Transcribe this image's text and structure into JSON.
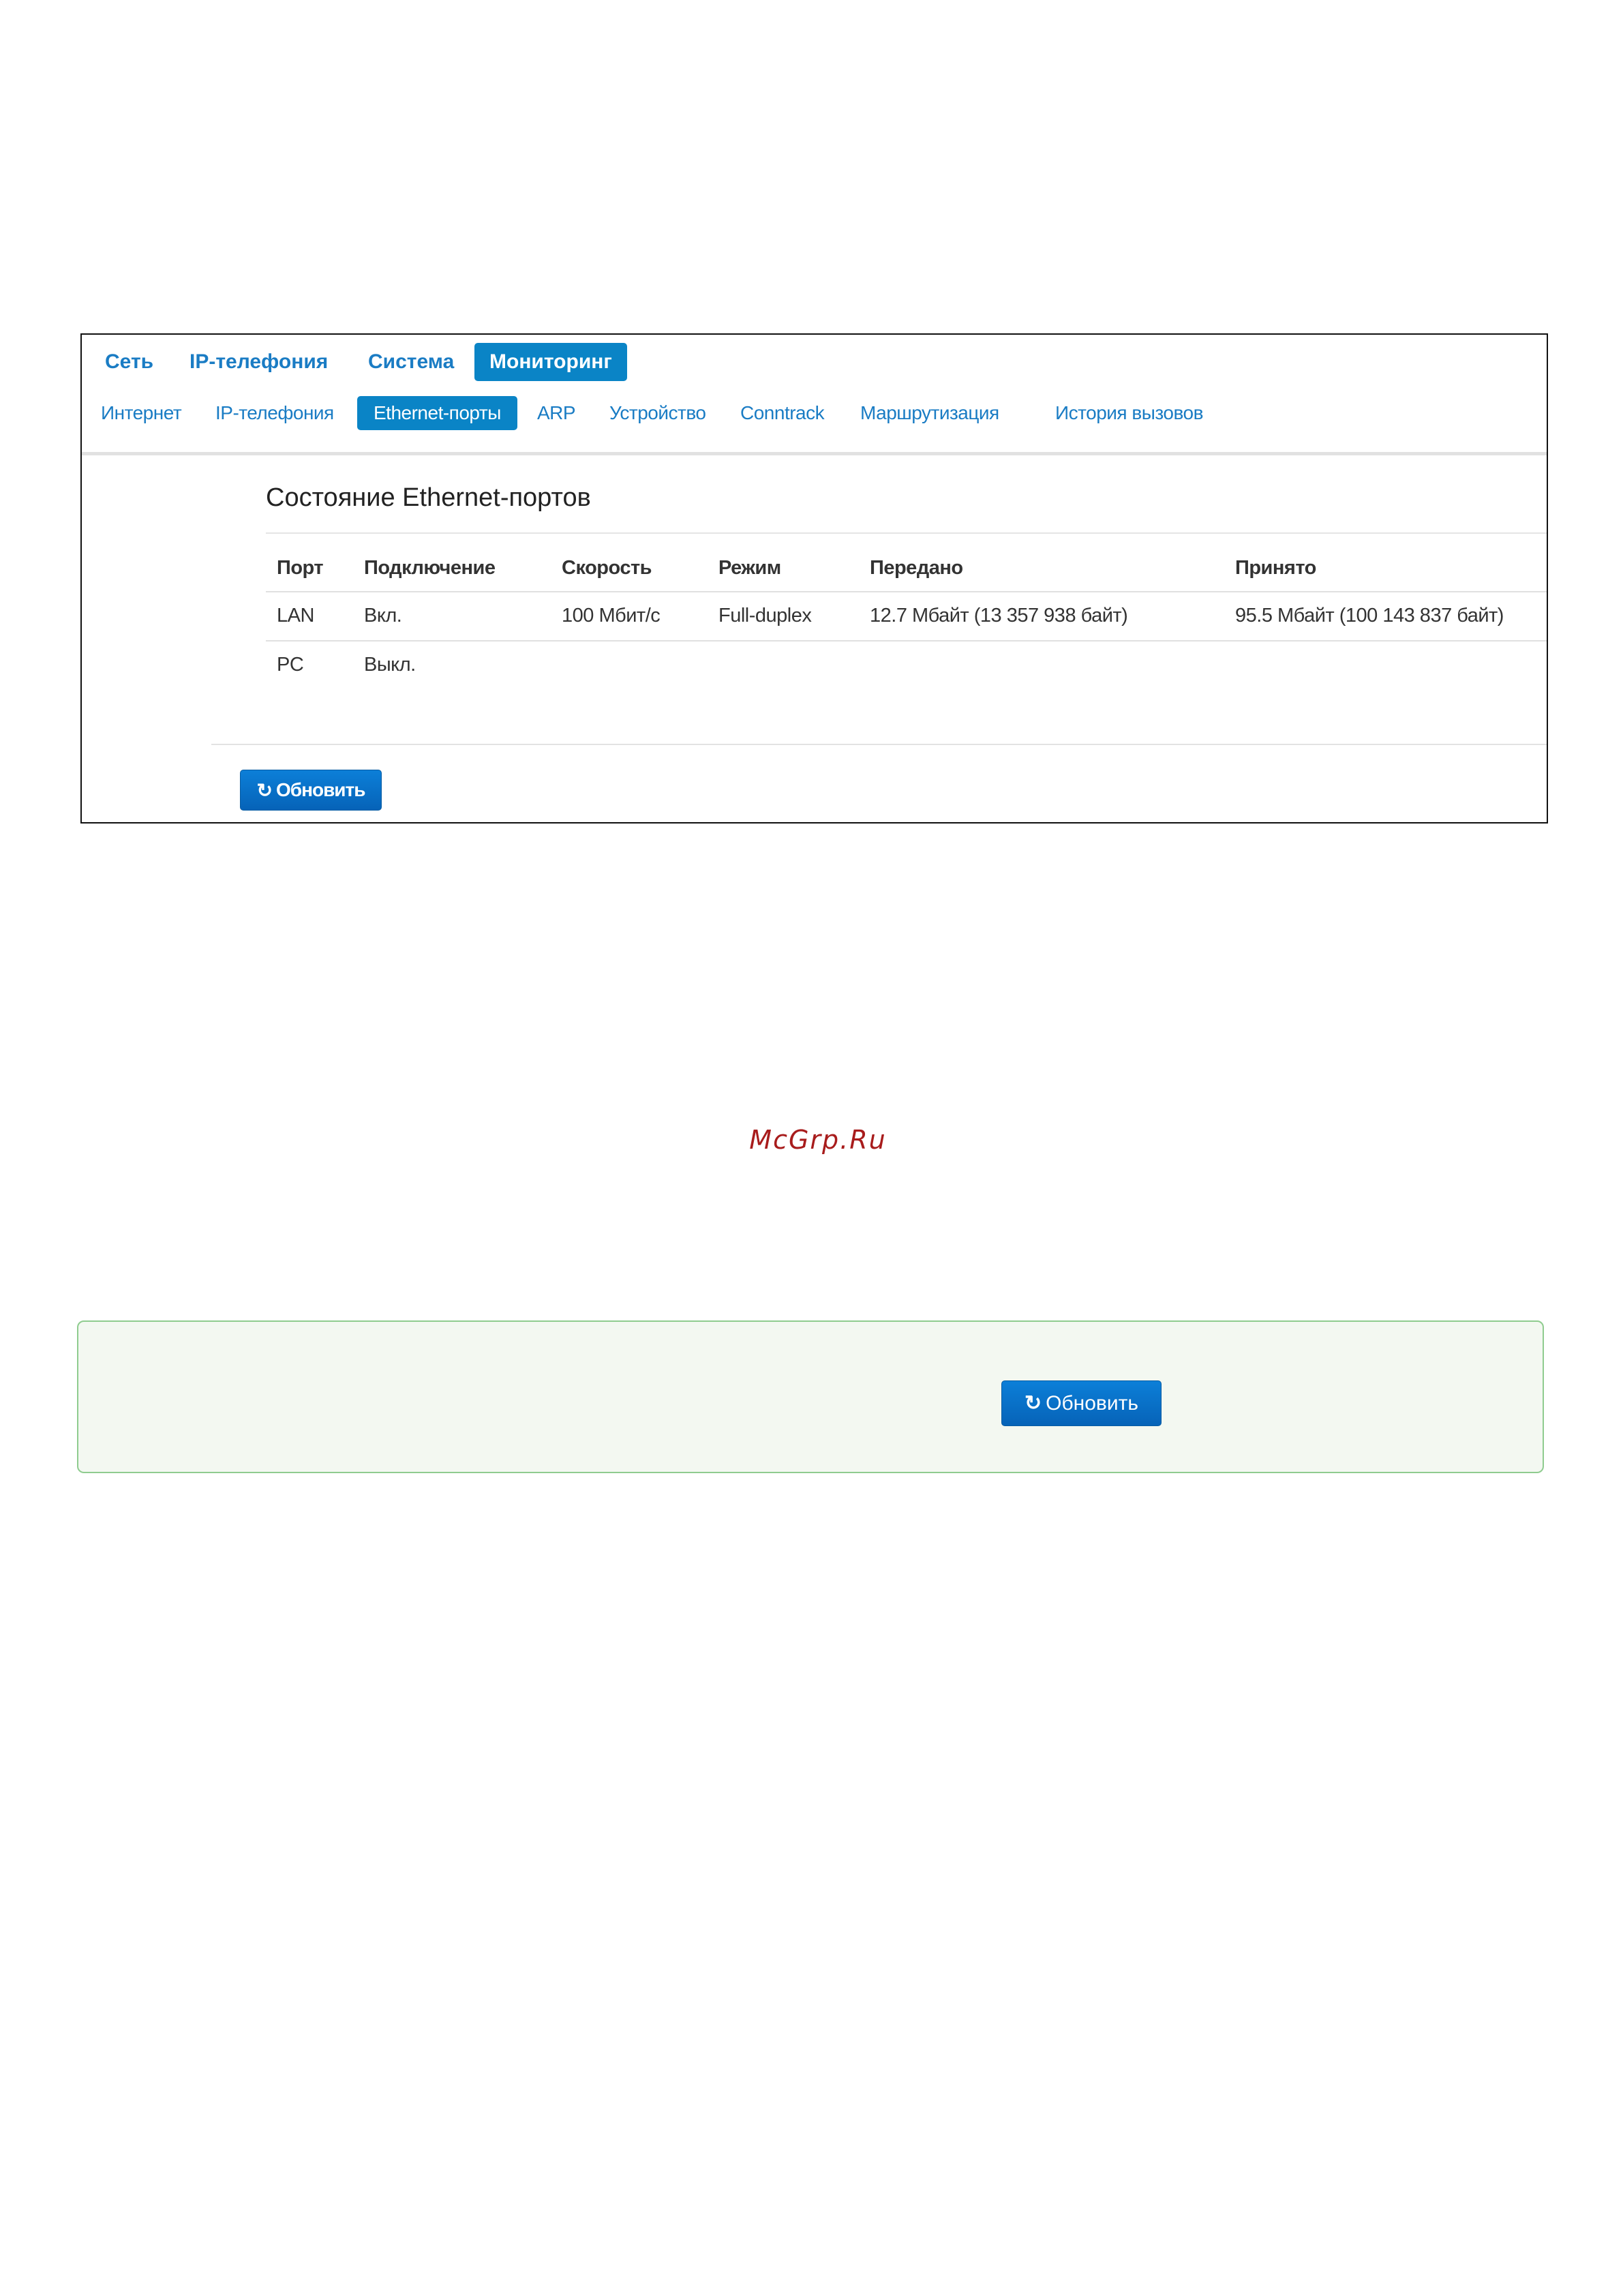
{
  "nav": {
    "top": [
      "Сеть",
      "IP-телефония",
      "Система",
      "Мониторинг"
    ],
    "top_active": "Мониторинг",
    "sub": [
      "Интернет",
      "IP-телефония",
      "Ethernet-порты",
      "ARP",
      "Устройство",
      "Conntrack",
      "Маршрутизация",
      "История вызовов"
    ],
    "sub_active": "Ethernet-порты"
  },
  "section": {
    "title": "Состояние Ethernet-портов"
  },
  "table": {
    "headers": [
      "Порт",
      "Подключение",
      "Скорость",
      "Режим",
      "Передано",
      "Принято"
    ],
    "rows": [
      [
        "LAN",
        "Вкл.",
        "100 Мбит/с",
        "Full-duplex",
        "12.7 Мбайт (13 357 938 байт)",
        "95.5 Мбайт (100 143 837 байт)"
      ],
      [
        "PC",
        "Выкл.",
        "",
        "",
        "",
        ""
      ]
    ]
  },
  "refresh_button": {
    "label": "Обновить",
    "icon": "refresh-icon"
  },
  "watermark": "McGrp.Ru",
  "note_box": {
    "button_label": "Обновить",
    "icon": "refresh-icon"
  },
  "colors": {
    "accent": "#0a84c6",
    "link": "#1a7cc4",
    "watermark": "#a81c1c",
    "note_border": "#8fcc8f",
    "note_bg": "#f3f8f1"
  }
}
